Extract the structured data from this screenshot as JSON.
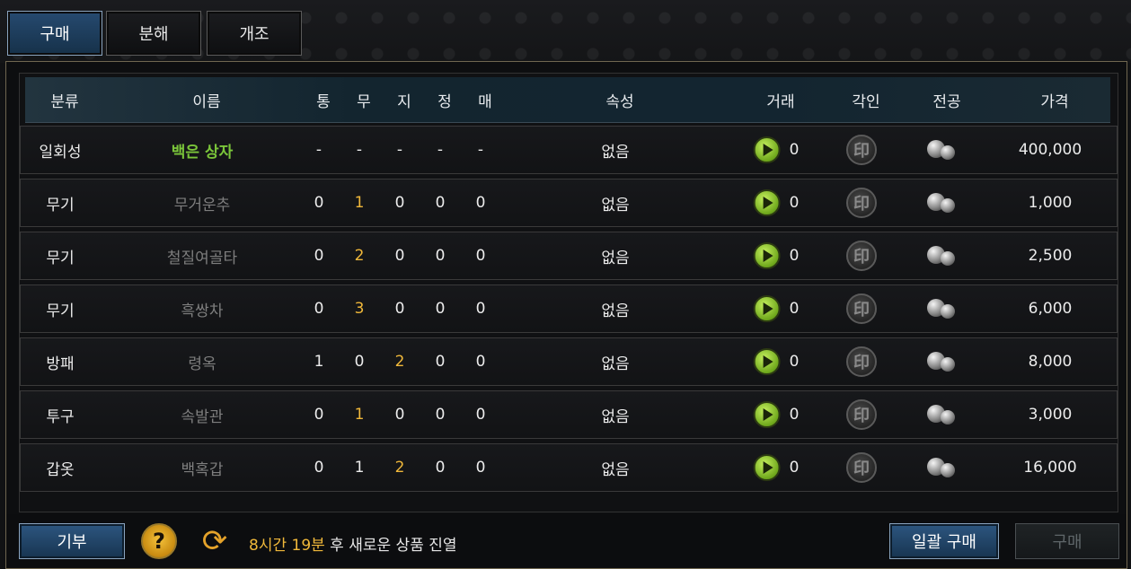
{
  "tabs": [
    {
      "label": "구매",
      "active": true
    },
    {
      "label": "분해",
      "active": false
    },
    {
      "label": "개조",
      "active": false
    }
  ],
  "columns": {
    "category": "분류",
    "name": "이름",
    "s1": "통",
    "s2": "무",
    "s3": "지",
    "s4": "정",
    "s5": "매",
    "attribute": "속성",
    "trade": "거래",
    "seal": "각인",
    "merit": "전공",
    "price": "가격"
  },
  "seal_glyph": "印",
  "rows": [
    {
      "category": "일회성",
      "name": "백은 상자",
      "name_color": "green",
      "s1": "-",
      "s2": "-",
      "s3": "-",
      "s4": "-",
      "s5": "-",
      "gold_index": -1,
      "attribute": "없음",
      "trade": "0",
      "price": "400,000"
    },
    {
      "category": "무기",
      "name": "무거운추",
      "name_color": "gray",
      "s1": "0",
      "s2": "1",
      "s3": "0",
      "s4": "0",
      "s5": "0",
      "gold_index": 2,
      "attribute": "없음",
      "trade": "0",
      "price": "1,000"
    },
    {
      "category": "무기",
      "name": "철질여골타",
      "name_color": "gray",
      "s1": "0",
      "s2": "2",
      "s3": "0",
      "s4": "0",
      "s5": "0",
      "gold_index": 2,
      "attribute": "없음",
      "trade": "0",
      "price": "2,500"
    },
    {
      "category": "무기",
      "name": "흑쌍차",
      "name_color": "gray",
      "s1": "0",
      "s2": "3",
      "s3": "0",
      "s4": "0",
      "s5": "0",
      "gold_index": 2,
      "attribute": "없음",
      "trade": "0",
      "price": "6,000"
    },
    {
      "category": "방패",
      "name": "령옥",
      "name_color": "gray",
      "s1": "1",
      "s2": "0",
      "s3": "2",
      "s4": "0",
      "s5": "0",
      "gold_index": 3,
      "attribute": "없음",
      "trade": "0",
      "price": "8,000"
    },
    {
      "category": "투구",
      "name": "속발관",
      "name_color": "gray",
      "s1": "0",
      "s2": "1",
      "s3": "0",
      "s4": "0",
      "s5": "0",
      "gold_index": 2,
      "attribute": "없음",
      "trade": "0",
      "price": "3,000"
    },
    {
      "category": "갑옷",
      "name": "백혹갑",
      "name_color": "gray",
      "s1": "0",
      "s2": "1",
      "s3": "2",
      "s4": "0",
      "s5": "0",
      "gold_index": 3,
      "attribute": "없음",
      "trade": "0",
      "price": "16,000"
    }
  ],
  "footer": {
    "donate_label": "기부",
    "help_glyph": "?",
    "refresh_glyph": "⟳",
    "notice_time": "8시간 19분",
    "notice_text": " 후 새로운 상품 진열",
    "bulk_buy_label": "일괄 구매",
    "buy_label": "구매"
  },
  "icons": {
    "trade": "arrow-right-circle-icon",
    "seal": "seal-stamp-icon",
    "merit": "pearl-icon",
    "help": "question-icon",
    "refresh": "refresh-icon"
  },
  "colors": {
    "gold": "#f0b83a",
    "green": "#7bc63a",
    "active_tab": "#264a70"
  }
}
